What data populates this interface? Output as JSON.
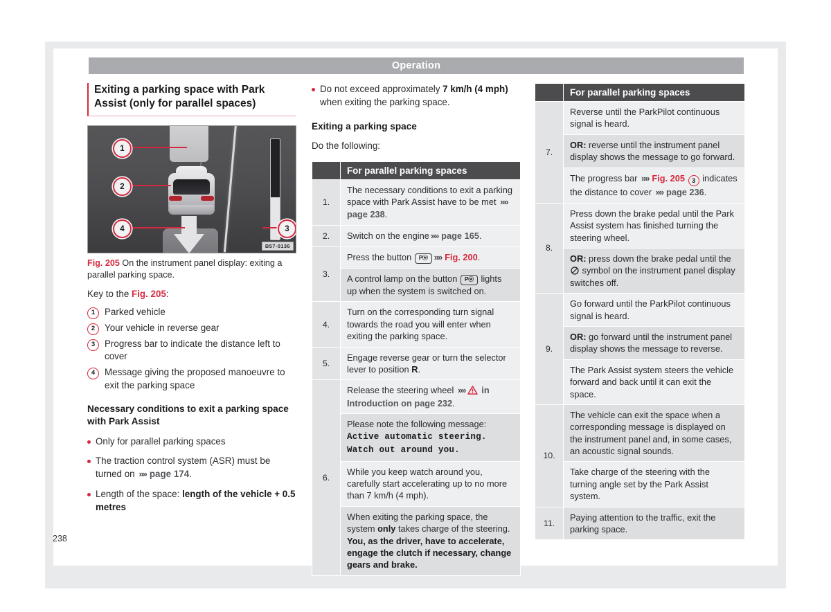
{
  "page": {
    "running_header": "Operation",
    "folio": "238"
  },
  "column_left": {
    "heading": "Exiting a parking space with Park Assist (only for parallel spaces)",
    "figure": {
      "image_code": "B57-0136",
      "caption_label": "Fig. 205",
      "caption_text": "On the instrument panel display: exiting a parallel parking space.",
      "callouts": [
        "1",
        "2",
        "3",
        "4"
      ]
    },
    "key_intro_prefix": "Key to the ",
    "key_intro_ref": "Fig. 205",
    "key_intro_suffix": ":",
    "key_items": [
      {
        "num": "1",
        "text": "Parked vehicle"
      },
      {
        "num": "2",
        "text": "Your vehicle in reverse gear"
      },
      {
        "num": "3",
        "text": "Progress bar to indicate the distance left to cover"
      },
      {
        "num": "4",
        "text": "Message giving the proposed manoeuvre to exit the parking space"
      }
    ],
    "conditions_heading": "Necessary conditions to exit a parking space with Park Assist",
    "conditions": [
      {
        "parts": [
          {
            "t": "Only for parallel parking spaces"
          }
        ]
      },
      {
        "parts": [
          {
            "t": "The traction control system (ASR) must be turned on "
          },
          {
            "t": "»",
            "k": "chev"
          },
          {
            "t": " page 174",
            "k": "ref"
          },
          {
            "t": "."
          }
        ]
      },
      {
        "parts": [
          {
            "t": "Length of the space: "
          },
          {
            "t": "length of the vehicle + 0.5 metres",
            "k": "bold"
          }
        ]
      }
    ]
  },
  "column_mid": {
    "lead_bullet": [
      {
        "t": "Do not exceed approximately "
      },
      {
        "t": "7 km/h (4 mph)",
        "k": "bold"
      },
      {
        "t": " when exiting the parking space."
      }
    ],
    "heading": "Exiting a parking space",
    "intro": "Do the following:",
    "table": {
      "header_num": "",
      "header_text": "For parallel parking spaces",
      "rows": [
        {
          "num": "1.",
          "blocks": [
            {
              "alt": false,
              "parts": [
                {
                  "t": "The necessary conditions to exit a parking space with Park Assist have to be met "
                },
                {
                  "t": "»",
                  "k": "chev"
                },
                {
                  "t": " page 238",
                  "k": "ref"
                },
                {
                  "t": "."
                }
              ]
            }
          ]
        },
        {
          "num": "2.",
          "blocks": [
            {
              "alt": false,
              "parts": [
                {
                  "t": "Switch on the engine"
                },
                {
                  "t": "»",
                  "k": "chev"
                },
                {
                  "t": " page 165",
                  "k": "ref"
                },
                {
                  "t": "."
                }
              ]
            }
          ]
        },
        {
          "num": "3.",
          "blocks": [
            {
              "alt": false,
              "parts": [
                {
                  "t": "Press the button "
                },
                {
                  "t": "P",
                  "k": "btn"
                },
                {
                  "t": "»",
                  "k": "chev"
                },
                {
                  "t": " Fig. 200",
                  "k": "red"
                },
                {
                  "t": "."
                }
              ]
            },
            {
              "alt": true,
              "parts": [
                {
                  "t": "A control lamp on the button "
                },
                {
                  "t": "P",
                  "k": "btn"
                },
                {
                  "t": " lights up when the system is switched on."
                }
              ]
            }
          ]
        },
        {
          "num": "4.",
          "blocks": [
            {
              "alt": false,
              "parts": [
                {
                  "t": "Turn on the corresponding turn signal towards the road you will enter when exiting the parking space."
                }
              ]
            }
          ]
        },
        {
          "num": "5.",
          "blocks": [
            {
              "alt": false,
              "parts": [
                {
                  "t": "Engage reverse gear or turn the selector lever to position "
                },
                {
                  "t": "R",
                  "k": "bold"
                },
                {
                  "t": "."
                }
              ]
            }
          ]
        },
        {
          "num": "6.",
          "blocks": [
            {
              "alt": false,
              "parts": [
                {
                  "t": "Release the steering wheel "
                },
                {
                  "t": "»",
                  "k": "chev"
                },
                {
                  "t": "⚠",
                  "k": "warn"
                },
                {
                  "t": " in Introduction on page 232",
                  "k": "ref"
                },
                {
                  "t": "."
                }
              ]
            },
            {
              "alt": true,
              "parts": [
                {
                  "t": "Please note the following message: "
                },
                {
                  "t": "Active automatic steering. Watch out around you.",
                  "k": "mono"
                }
              ]
            },
            {
              "alt": false,
              "parts": [
                {
                  "t": "While you keep watch around you, carefully start accelerating up to no more than 7 km/h (4 mph)."
                }
              ]
            },
            {
              "alt": true,
              "parts": [
                {
                  "t": "When exiting the parking space, the system "
                },
                {
                  "t": "only",
                  "k": "bold"
                },
                {
                  "t": " takes charge of the steering. "
                },
                {
                  "t": "You, as the driver, have to accelerate, engage the clutch if necessary, change gears and brake.",
                  "k": "bold"
                }
              ]
            }
          ]
        }
      ]
    }
  },
  "column_right": {
    "table": {
      "header_num": "",
      "header_text": "For parallel parking spaces",
      "rows": [
        {
          "num": "7.",
          "blocks": [
            {
              "alt": false,
              "parts": [
                {
                  "t": "Reverse until the ParkPilot continuous signal is heard."
                }
              ]
            },
            {
              "alt": true,
              "parts": [
                {
                  "t": "OR:",
                  "k": "bold"
                },
                {
                  "t": " reverse until the instrument panel display shows the message to go forward."
                }
              ]
            },
            {
              "alt": false,
              "parts": [
                {
                  "t": "The progress bar "
                },
                {
                  "t": "»",
                  "k": "chev"
                },
                {
                  "t": " Fig. 205 ",
                  "k": "red"
                },
                {
                  "t": "3",
                  "k": "circ"
                },
                {
                  "t": " indicates the distance to cover "
                },
                {
                  "t": "»",
                  "k": "chev"
                },
                {
                  "t": " page 236",
                  "k": "ref"
                },
                {
                  "t": "."
                }
              ]
            }
          ]
        },
        {
          "num": "8.",
          "blocks": [
            {
              "alt": false,
              "parts": [
                {
                  "t": "Press down the brake pedal until the Park Assist system has finished turning the steering wheel."
                }
              ]
            },
            {
              "alt": true,
              "parts": [
                {
                  "t": "OR:",
                  "k": "bold"
                },
                {
                  "t": " press down the brake pedal until the "
                },
                {
                  "t": "⊘",
                  "k": "nosym"
                },
                {
                  "t": " symbol on the instrument panel display switches off."
                }
              ]
            }
          ]
        },
        {
          "num": "9.",
          "blocks": [
            {
              "alt": false,
              "parts": [
                {
                  "t": "Go forward until the ParkPilot continuous signal is heard."
                }
              ]
            },
            {
              "alt": true,
              "parts": [
                {
                  "t": "OR:",
                  "k": "bold"
                },
                {
                  "t": " go forward until the instrument panel display shows the message to reverse."
                }
              ]
            },
            {
              "alt": false,
              "parts": [
                {
                  "t": "The Park Assist system steers the vehicle forward and back until it can exit the space."
                }
              ]
            }
          ]
        },
        {
          "num": "10.",
          "blocks": [
            {
              "alt": true,
              "parts": [
                {
                  "t": "The vehicle can exit the space when a corresponding message is displayed on the instrument panel and, in some cases, an acoustic signal sounds."
                }
              ]
            },
            {
              "alt": false,
              "parts": [
                {
                  "t": "Take charge of the steering with the turning angle set by the Park Assist system."
                }
              ]
            }
          ]
        },
        {
          "num": "11.",
          "blocks": [
            {
              "alt": true,
              "parts": [
                {
                  "t": "Paying attention to the traffic, exit the parking space."
                }
              ]
            }
          ]
        }
      ]
    }
  }
}
